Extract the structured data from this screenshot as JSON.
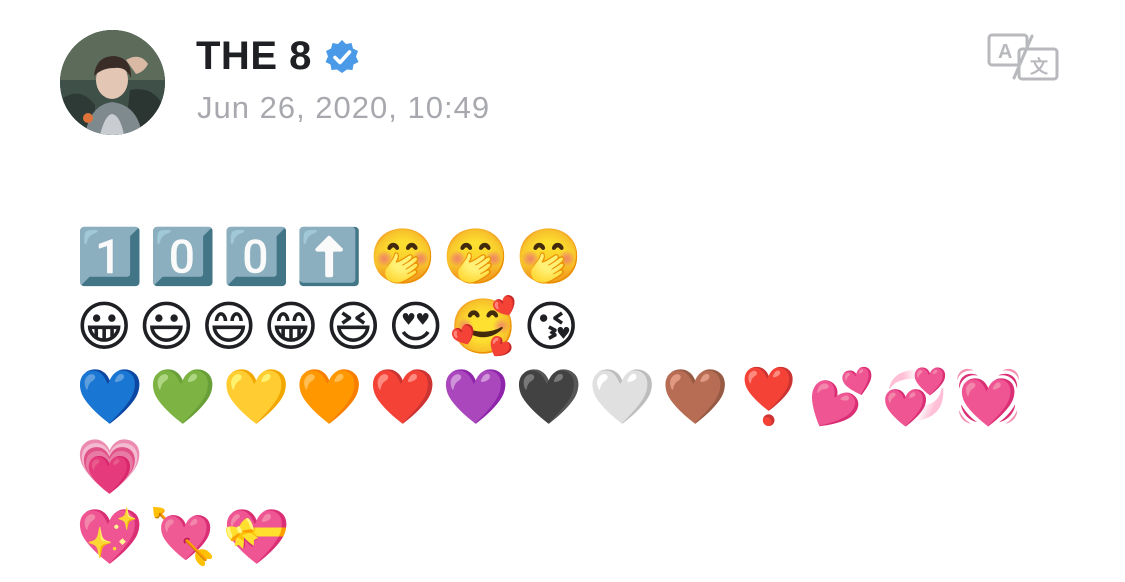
{
  "post": {
    "author": {
      "name": "THE 8",
      "verified": true,
      "avatar_icon": "profile-photo"
    },
    "timestamp": "Jun 26, 2020, 10:49",
    "translate_icon": "translate-icon",
    "body": "1️⃣0️⃣0️⃣⬆️🤭🤭🤭\n😀😃😄😁😆😍🥰😘\n💙💚💛🧡❤️💜🖤🤍🤎❣️💕💞💓💗\n💖💘💝"
  },
  "colors": {
    "name": "#1f2024",
    "timestamp": "#a8a9ae",
    "verified_badge": "#4a9ae8",
    "translate_icon": "#b8b9bd"
  }
}
